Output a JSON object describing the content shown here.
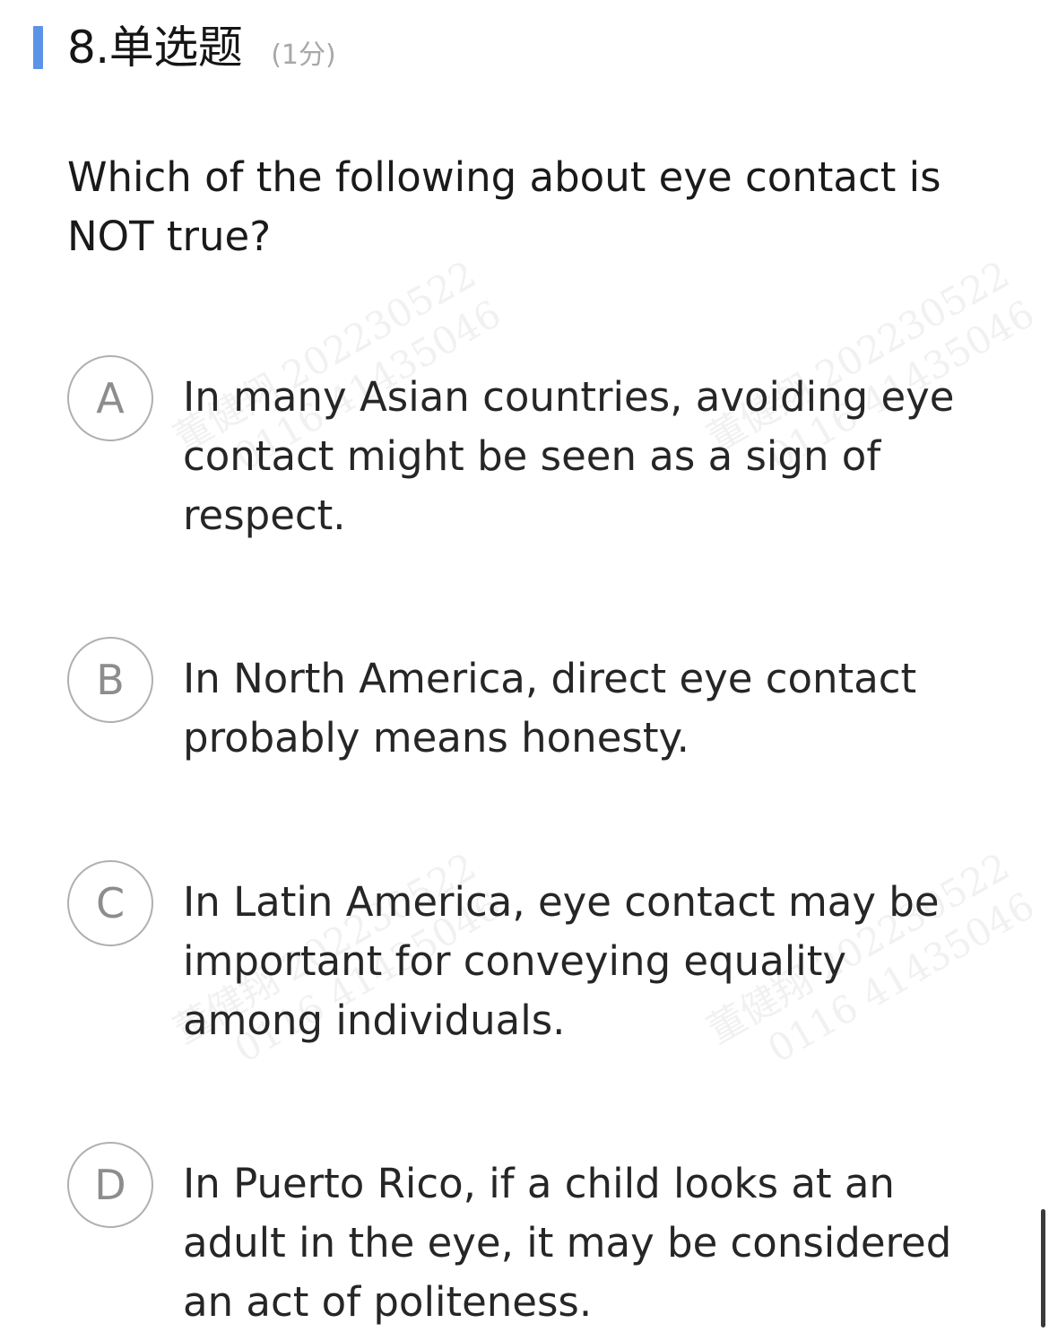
{
  "question": {
    "number_title": "8.单选题",
    "score": "(1分)",
    "stem": "Which of the following about eye contact is NOT true?"
  },
  "options": [
    {
      "letter": "A",
      "text": "In many Asian countries, avoiding eye contact might be seen as a sign of respect."
    },
    {
      "letter": "B",
      "text": "In North America, direct eye contact probably means honesty."
    },
    {
      "letter": "C",
      "text": "In Latin America, eye contact may be important for conveying equality among individuals."
    },
    {
      "letter": "D",
      "text": "In Puerto Rico, if a child looks at an adult in the eye, it may be considered an act of politeness."
    }
  ],
  "watermark": {
    "line1": "董健翔 202230522",
    "line2": "0116 41435046"
  },
  "colors": {
    "accent": "#5a93e8",
    "option_circle_border": "#b0b0b0",
    "option_letter": "#8d8d8d",
    "score_text": "#a8a8a8"
  }
}
